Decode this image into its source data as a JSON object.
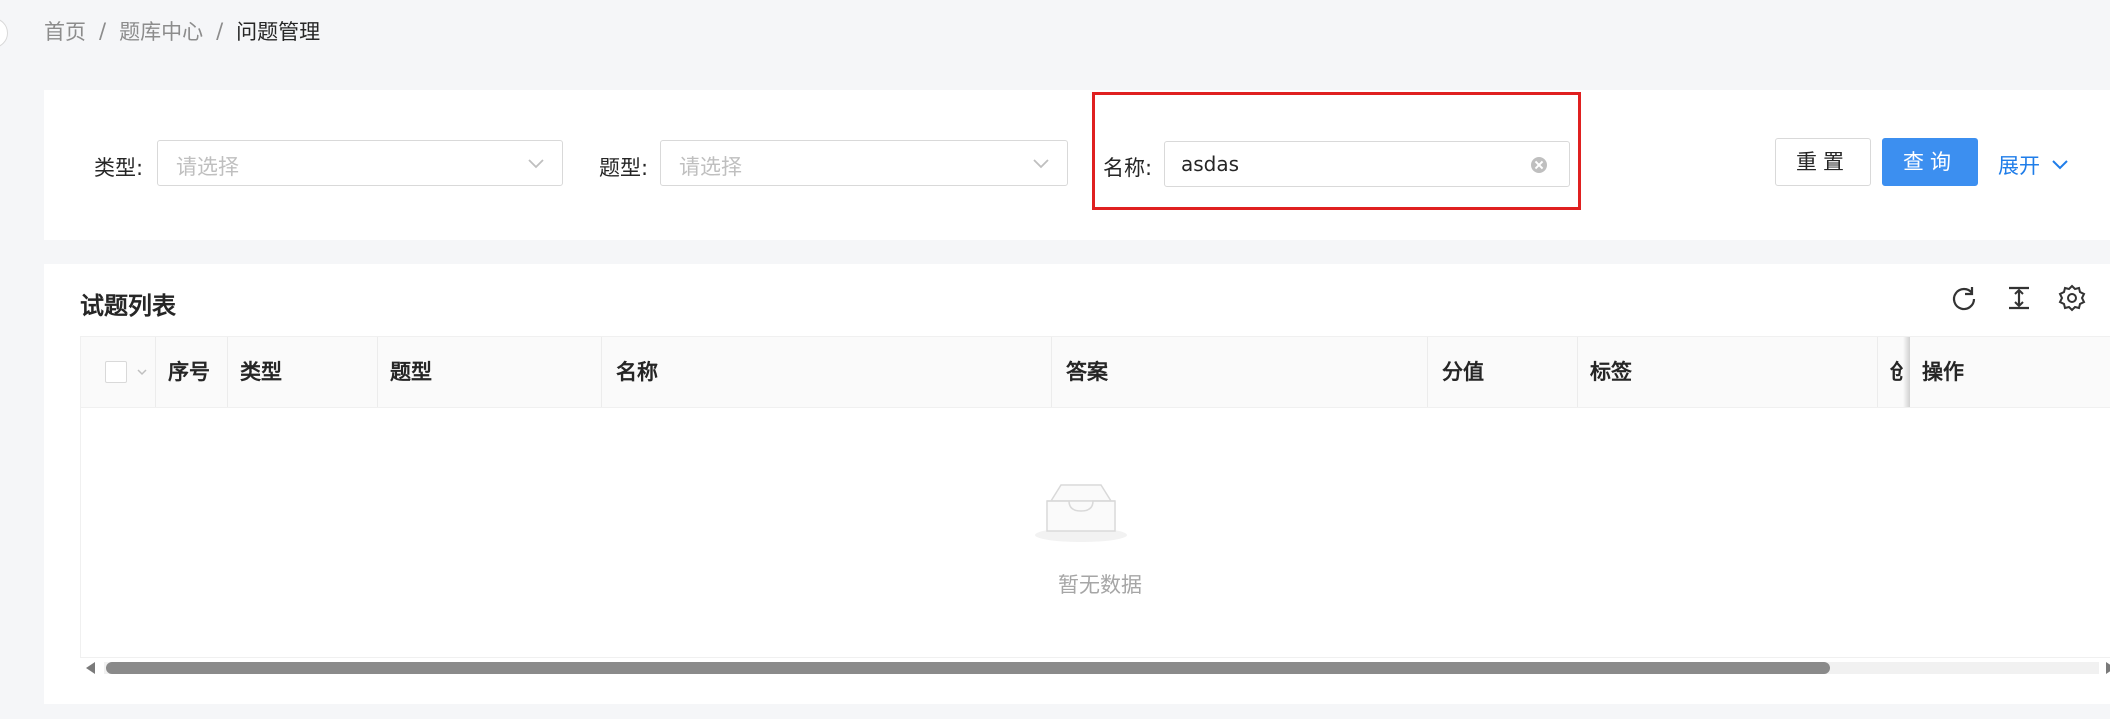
{
  "breadcrumb": {
    "items": [
      "首页",
      "题库中心",
      "问题管理"
    ],
    "separator": "/"
  },
  "filters": {
    "type_label": "类型:",
    "type_placeholder": "请选择",
    "question_type_label": "题型:",
    "question_type_placeholder": "请选择",
    "name_label": "名称:",
    "name_value": "asdas"
  },
  "actions": {
    "reset_label": "重置",
    "query_label": "查询",
    "expand_label": "展开"
  },
  "table_card": {
    "title": "试题列表",
    "toolbar_icons": [
      "refresh-icon",
      "column-height-icon",
      "settings-icon"
    ],
    "columns": [
      "序号",
      "类型",
      "题型",
      "名称",
      "答案",
      "分值",
      "标签",
      "创",
      "操作"
    ],
    "empty_text": "暂无数据"
  },
  "colors": {
    "primary": "#3c8ff0",
    "link": "#1f7de9",
    "highlight": "#e02020",
    "background": "#f5f6f8"
  }
}
